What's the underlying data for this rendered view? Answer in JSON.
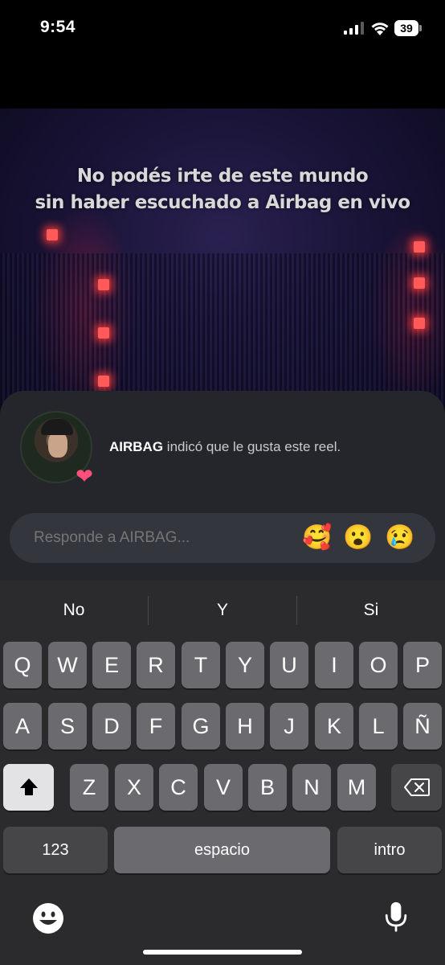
{
  "status_bar": {
    "time": "9:54",
    "battery": "39"
  },
  "video": {
    "caption_line1": "No podés irte de este mundo",
    "caption_line2": "sin haber escuchado a Airbag en vivo"
  },
  "notification": {
    "username": "AIRBAG",
    "message": " indicó que le gusta este reel.",
    "badge_icon": "heart-icon"
  },
  "reply": {
    "placeholder": "Responde a AIRBAG...",
    "emojis": [
      "🥰",
      "😮",
      "😢"
    ]
  },
  "keyboard": {
    "suggestions": [
      "No",
      "Y",
      "Si"
    ],
    "row1": [
      "Q",
      "W",
      "E",
      "R",
      "T",
      "Y",
      "U",
      "I",
      "O",
      "P"
    ],
    "row2": [
      "A",
      "S",
      "D",
      "F",
      "G",
      "H",
      "J",
      "K",
      "L",
      "Ñ"
    ],
    "row3": [
      "Z",
      "X",
      "C",
      "V",
      "B",
      "N",
      "M"
    ],
    "numbers_key": "123",
    "space_key": "espacio",
    "return_key": "intro",
    "icons": {
      "shift": "shift-icon",
      "delete": "backspace-icon",
      "emoji": "emoji-icon",
      "dictation": "microphone-icon"
    }
  },
  "colors": {
    "sheet": "#24262b",
    "keyboard": "#2b2b2d",
    "key": "#6b6b6f",
    "reply_box": "#33363c"
  }
}
